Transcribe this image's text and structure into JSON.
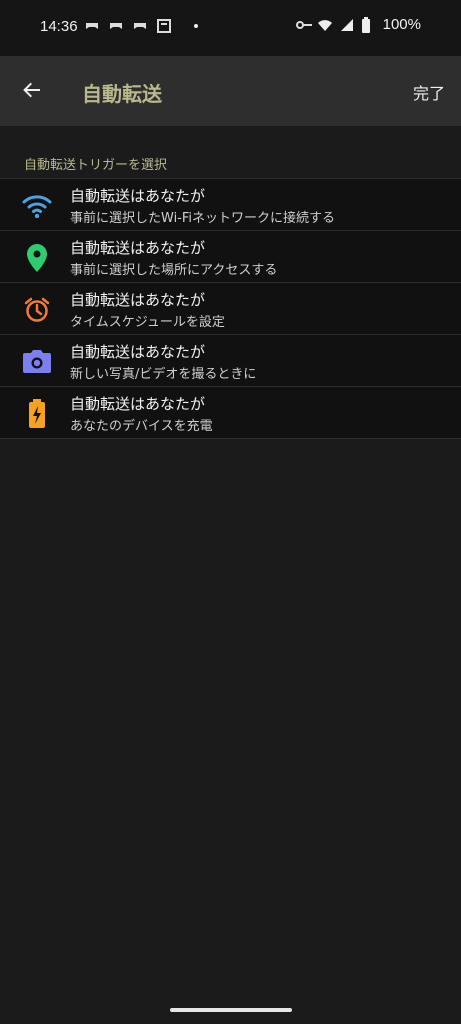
{
  "status_bar": {
    "time": "14:36",
    "battery": "100%"
  },
  "app_bar": {
    "title": "自動転送",
    "done": "完了"
  },
  "section": {
    "label": "自動転送トリガーを選択"
  },
  "items": [
    {
      "title": "自動転送はあなたが",
      "subtitle": "事前に選択したWi-Fiネットワークに接続する",
      "icon": "wifi-icon",
      "color": "#4aa3e0"
    },
    {
      "title": "自動転送はあなたが",
      "subtitle": "事前に選択した場所にアクセスする",
      "icon": "location-pin-icon",
      "color": "#2ecc71"
    },
    {
      "title": "自動転送はあなたが",
      "subtitle": "タイムスケジュールを設定",
      "icon": "alarm-clock-icon",
      "color": "#f07a3c"
    },
    {
      "title": "自動転送はあなたが",
      "subtitle": "新しい写真/ビデオを撮るときに",
      "icon": "camera-icon",
      "color": "#7b7ff0"
    },
    {
      "title": "自動転送はあなたが",
      "subtitle": "あなたのデバイスを充電",
      "icon": "battery-charging-icon",
      "color": "#f5a123"
    }
  ]
}
